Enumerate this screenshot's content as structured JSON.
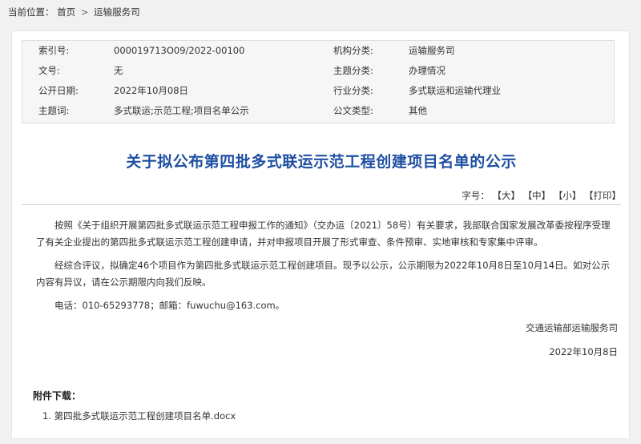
{
  "breadcrumb": {
    "label": "当前位置：",
    "home": "首页",
    "sep": ">",
    "current": "运输服务司"
  },
  "meta": {
    "rows": [
      {
        "k1": "索引号:",
        "v1": "000019713O09/2022-00100",
        "k2": "机构分类:",
        "v2": "运输服务司"
      },
      {
        "k1": "文号:",
        "v1": "无",
        "k2": "主题分类:",
        "v2": "办理情况"
      },
      {
        "k1": "公开日期:",
        "v1": "2022年10月08日",
        "k2": "行业分类:",
        "v2": "多式联运和运输代理业"
      },
      {
        "k1": "主题词:",
        "v1": "多式联运;示范工程;项目名单公示",
        "k2": "公文类型:",
        "v2": "其他"
      }
    ]
  },
  "title": "关于拟公布第四批多式联运示范工程创建项目名单的公示",
  "fontsize": {
    "label": "字号：",
    "large": "【大】",
    "medium": "【中】",
    "small": "【小】",
    "print": "【打印】"
  },
  "body": {
    "p1": "按照《关于组织开展第四批多式联运示范工程申报工作的通知》（交办运〔2021〕58号）有关要求，我部联合国家发展改革委按程序受理了有关企业提出的第四批多式联运示范工程创建申请，并对申报项目开展了形式审查、条件预审、实地审核和专家集中评审。",
    "p2": "经综合评议，拟确定46个项目作为第四批多式联运示范工程创建项目。现予以公示，公示期限为2022年10月8日至10月14日。如对公示内容有异议，请在公示期限内向我们反映。",
    "contact": "电话：010-65293778；邮箱：fuwuchu@163.com。",
    "sign_org": "交通运输部运输服务司",
    "sign_date": "2022年10月8日"
  },
  "attachments": {
    "title": "附件下载：",
    "items": [
      "1. 第四批多式联运示范工程创建项目名单.docx"
    ]
  }
}
